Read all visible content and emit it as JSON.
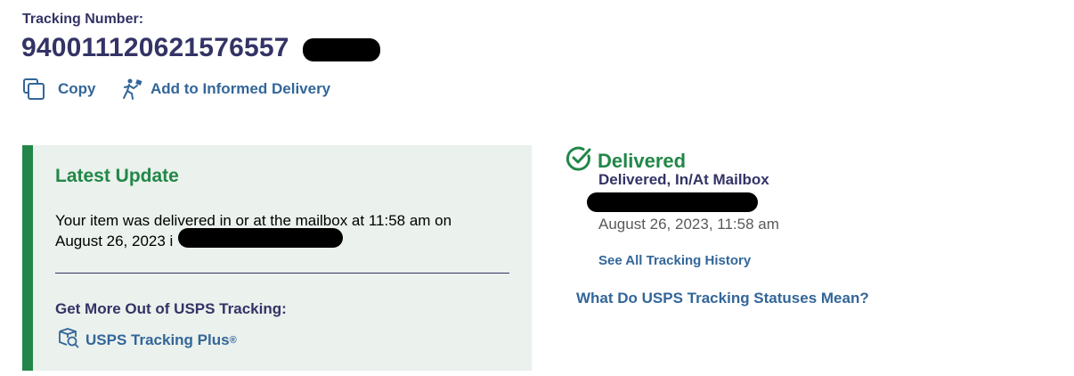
{
  "header": {
    "tracking_label": "Tracking Number:",
    "tracking_number_visible": "940011120621576557"
  },
  "actions": {
    "copy_label": "Copy",
    "informed_delivery_label": "Add to Informed Delivery"
  },
  "latest_update": {
    "title": "Latest Update",
    "body_line1": "Your item was delivered in or at the mailbox at 11:58 am on",
    "body_line2_prefix": "August 26, 2023 i",
    "body_line2_suffix": ".",
    "get_more_label": "Get More Out of USPS Tracking:",
    "tracking_plus_label": "USPS Tracking Plus",
    "tracking_plus_mark": "®"
  },
  "status": {
    "title": "Delivered",
    "detail": "Delivered, In/At Mailbox",
    "date": "August 26, 2023, 11:58 am",
    "history_link": "See All Tracking History",
    "statuses_link": "What Do USPS Tracking Statuses Mean?"
  },
  "colors": {
    "navy": "#333366",
    "link_blue": "#336699",
    "success_green": "#218748",
    "panel_bg": "#ebf1ec",
    "redaction": "#000000"
  },
  "icons": {
    "copy": "copy-icon",
    "informed_delivery": "mail-carrier-icon",
    "tracking_plus": "package-search-icon",
    "status": "check-circle-icon"
  }
}
